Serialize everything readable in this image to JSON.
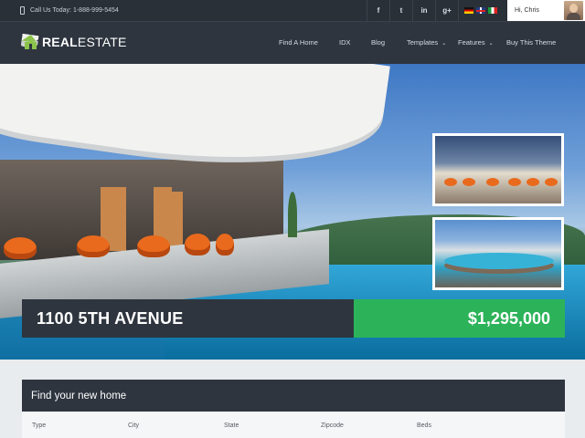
{
  "topbar": {
    "phone_text": "Call Us Today: 1-888-999-5454",
    "social": [
      {
        "icon": "facebook-icon",
        "glyph": "f"
      },
      {
        "icon": "twitter-icon",
        "glyph": "t"
      },
      {
        "icon": "linkedin-icon",
        "glyph": "in"
      },
      {
        "icon": "googleplus-icon",
        "glyph": "g+"
      }
    ],
    "languages": [
      "de-flag-icon",
      "uk-flag-icon",
      "it-flag-icon"
    ],
    "user_greeting": "Hi, Chris"
  },
  "nav": {
    "logo_bold": "REAL",
    "logo_rest": "ESTATE",
    "items": [
      "Find A Home",
      "IDX",
      "Blog",
      "Templates",
      "Features",
      "Buy This Theme"
    ]
  },
  "hero": {
    "title": "1100 5TH AVENUE",
    "price": "$1,295,000"
  },
  "search": {
    "heading": "Find your new home",
    "fields": [
      "Type",
      "City",
      "State",
      "Zipcode",
      "Beds"
    ]
  },
  "colors": {
    "dark": "#2e353f",
    "accent_green": "#2cb35a",
    "logo_green": "#8bc34a"
  }
}
